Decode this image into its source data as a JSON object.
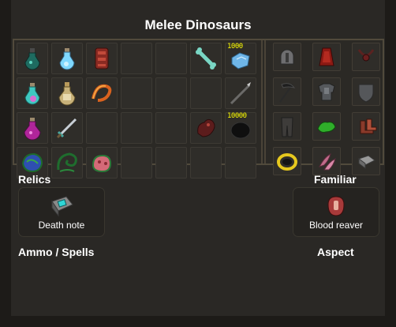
{
  "title": "Melee Dinosaurs",
  "inventory": [
    {
      "name": "green-potion-icon",
      "qty": ""
    },
    {
      "name": "blue-potion-icon",
      "qty": ""
    },
    {
      "name": "red-armour-piece-icon",
      "qty": ""
    },
    {
      "name": "",
      "qty": ""
    },
    {
      "name": "",
      "qty": ""
    },
    {
      "name": "bone-icon",
      "qty": ""
    },
    {
      "name": "blue-rune-stack-icon",
      "qty": "1000"
    },
    {
      "name": "teal-potion-icon",
      "qty": ""
    },
    {
      "name": "golden-potion-icon",
      "qty": ""
    },
    {
      "name": "fire-whip-icon",
      "qty": ""
    },
    {
      "name": "",
      "qty": ""
    },
    {
      "name": "",
      "qty": ""
    },
    {
      "name": "",
      "qty": ""
    },
    {
      "name": "spear-icon",
      "qty": ""
    },
    {
      "name": "pink-potion-icon",
      "qty": ""
    },
    {
      "name": "sword-icon",
      "qty": ""
    },
    {
      "name": "",
      "qty": ""
    },
    {
      "name": "",
      "qty": ""
    },
    {
      "name": "",
      "qty": ""
    },
    {
      "name": "red-creature-icon",
      "qty": ""
    },
    {
      "name": "black-rune-pouch-icon",
      "qty": "10000"
    },
    {
      "name": "blue-green-herb-icon",
      "qty": ""
    },
    {
      "name": "green-serpent-icon",
      "qty": ""
    },
    {
      "name": "pink-creature-icon",
      "qty": ""
    },
    {
      "name": "",
      "qty": ""
    },
    {
      "name": "",
      "qty": ""
    },
    {
      "name": "",
      "qty": ""
    },
    {
      "name": "",
      "qty": ""
    }
  ],
  "equipment": [
    {
      "name": "helmet-icon"
    },
    {
      "name": "red-cape-icon"
    },
    {
      "name": "amulet-icon"
    },
    {
      "name": "scythe-weapon-icon"
    },
    {
      "name": "platebody-icon"
    },
    {
      "name": "shield-icon"
    },
    {
      "name": "platelegs-icon"
    },
    {
      "name": "green-gloves-icon"
    },
    {
      "name": "boots-icon"
    },
    {
      "name": "ring-icon"
    },
    {
      "name": "pink-claws-icon"
    },
    {
      "name": "book-icon"
    }
  ],
  "relics": {
    "label": "Relics",
    "item": "Death note"
  },
  "familiar": {
    "label": "Familiar",
    "item": "Blood reaver"
  },
  "ammo": {
    "label": "Ammo / Spells"
  },
  "aspect": {
    "label": "Aspect"
  },
  "colors": {
    "background": "#2a2825",
    "frame": "#514a3c",
    "qty_text": "#ffff00"
  }
}
